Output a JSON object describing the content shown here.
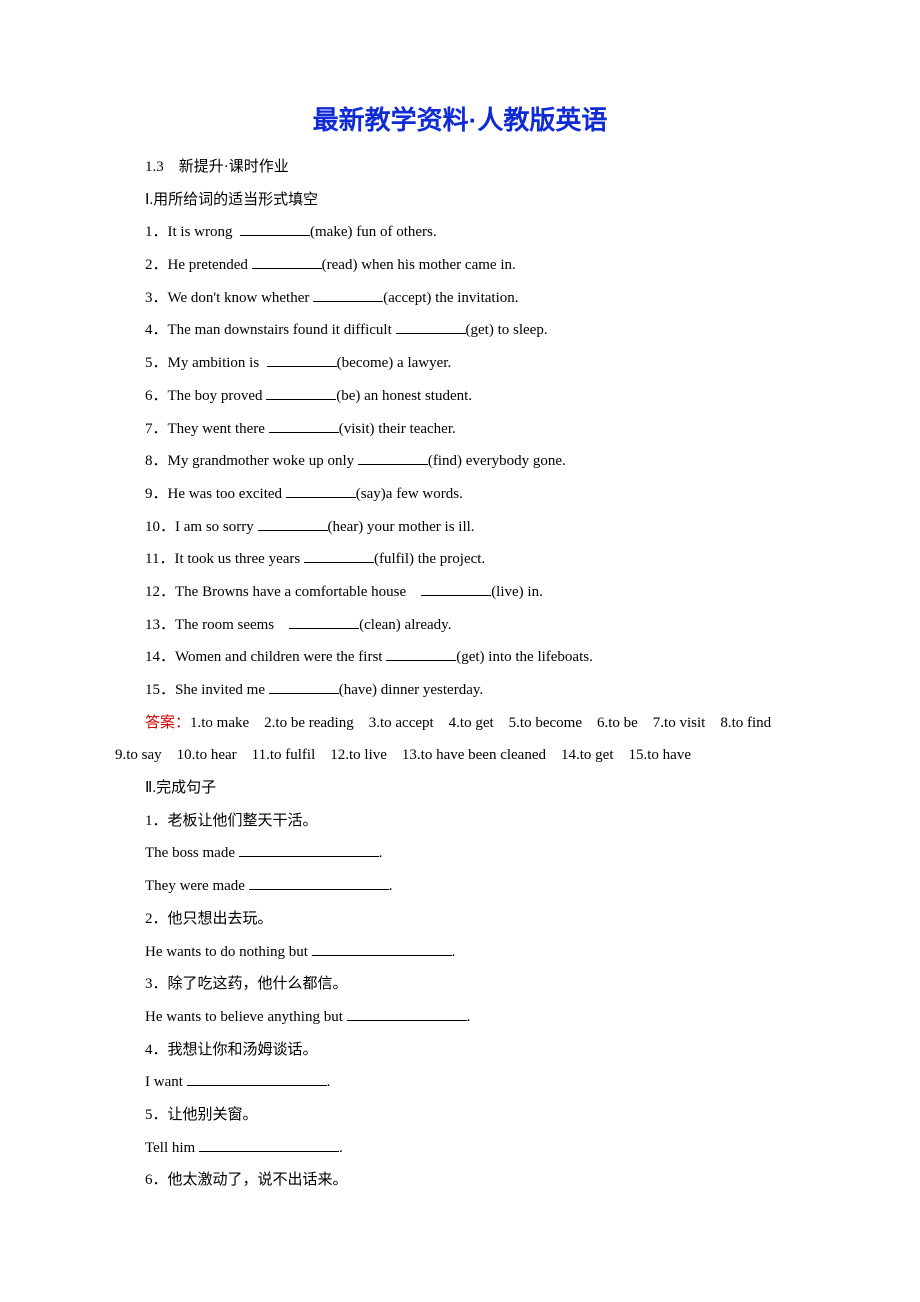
{
  "title": "最新教学资料·人教版英语",
  "subheading": "1.3　新提升·课时作业",
  "section1_heading": "Ⅰ.用所给词的适当形式填空",
  "q1_a": "1．It is wrong  ",
  "q1_b": "(make) fun of others.",
  "q2_a": "2．He pretended ",
  "q2_b": "(read) when his mother came in.",
  "q3_a": "3．We don't know whether ",
  "q3_b": "(accept) the invitation.",
  "q4_a": "4．The man downstairs found it difficult ",
  "q4_b": "(get) to sleep.",
  "q5_a": "5．My ambition is  ",
  "q5_b": "(become) a lawyer.",
  "q6_a": "6．The boy proved ",
  "q6_b": "(be) an honest student.",
  "q7_a": "7．They went there ",
  "q7_b": "(visit) their teacher.",
  "q8_a": "8．My grandmother woke up only ",
  "q8_b": "(find) everybody gone.",
  "q9_a": "9．He was too excited ",
  "q9_b": "(say)a few words.",
  "q10_a": "10．I am so sorry ",
  "q10_b": "(hear) your mother is ill.",
  "q11_a": "11．It took us three years ",
  "q11_b": "(fulfil) the project.",
  "q12_a": "12．The Browns have a comfortable house    ",
  "q12_b": "(live) in.",
  "q13_a": "13．The room seems    ",
  "q13_b": "(clean) already.",
  "q14_a": "14．Women and children were the first ",
  "q14_b": "(get) into the lifeboats.",
  "q15_a": "15．She invited me ",
  "q15_b": "(have) dinner yesterday.",
  "answers_label": "答案：",
  "answers_text": "1.to make　2.to be reading　3.to accept　4.to get　5.to become　6.to be　7.to visit　8.to find　9.to say　10.to hear　11.to fulfil　12.to live　13.to have been cleaned　14.to get　15.to have",
  "section2_heading": "Ⅱ.完成句子",
  "s2_q1": "1．老板让他们整天干活。",
  "s2_q1a_a": "The boss made ",
  "s2_q1a_b": ".",
  "s2_q1b_a": "They were made ",
  "s2_q1b_b": ".",
  "s2_q2": "2．他只想出去玩。",
  "s2_q2a_a": "He wants to do nothing but ",
  "s2_q2a_b": ".",
  "s2_q3": "3．除了吃这药，他什么都信。",
  "s2_q3a_a": "He wants to believe anything but ",
  "s2_q3a_b": ".",
  "s2_q4": "4．我想让你和汤姆谈话。",
  "s2_q4a_a": "I want ",
  "s2_q4a_b": ".",
  "s2_q5": "5．让他别关窗。",
  "s2_q5a_a": "Tell him ",
  "s2_q5a_b": ".",
  "s2_q6": "6．他太激动了，说不出话来。"
}
